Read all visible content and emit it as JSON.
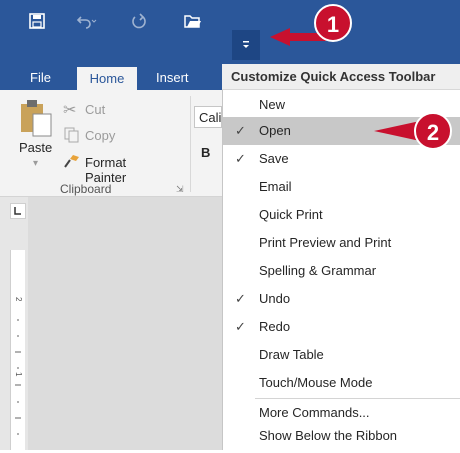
{
  "qat": {
    "save_icon": "save-icon",
    "undo_icon": "undo-icon",
    "redo_icon": "redo-icon",
    "open_icon": "folder-open-icon",
    "customize_icon": "customize-qat-dropdown-icon"
  },
  "tabs": [
    {
      "label": "File"
    },
    {
      "label": "Home"
    },
    {
      "label": "Insert"
    }
  ],
  "ribbon": {
    "paste_label": "Paste",
    "cut_label": "Cut",
    "copy_label": "Copy",
    "format_painter_label": "Format Painter",
    "clipboard_group_label": "Clipboard",
    "font_name_partial": "Cali",
    "bold_label": "B"
  },
  "menu": {
    "header": "Customize Quick Access Toolbar",
    "items": [
      {
        "label": "New",
        "checked": false
      },
      {
        "label": "Open",
        "checked": true,
        "highlighted": true
      },
      {
        "label": "Save",
        "checked": true
      },
      {
        "label": "Email",
        "checked": false
      },
      {
        "label": "Quick Print",
        "checked": false
      },
      {
        "label": "Print Preview and Print",
        "checked": false
      },
      {
        "label": "Spelling & Grammar",
        "checked": false
      },
      {
        "label": "Undo",
        "checked": true
      },
      {
        "label": "Redo",
        "checked": true
      },
      {
        "label": "Draw Table",
        "checked": false
      },
      {
        "label": "Touch/Mouse Mode",
        "checked": false
      },
      {
        "label": "More Commands...",
        "checked": false
      },
      {
        "label": "Show Below the Ribbon",
        "checked": false
      }
    ],
    "check_glyph": "✓"
  },
  "callouts": [
    {
      "number": "1"
    },
    {
      "number": "2"
    }
  ],
  "colors": {
    "accent": "#2b579a",
    "callout": "#c8102e",
    "highlight": "#c8c8c8"
  }
}
